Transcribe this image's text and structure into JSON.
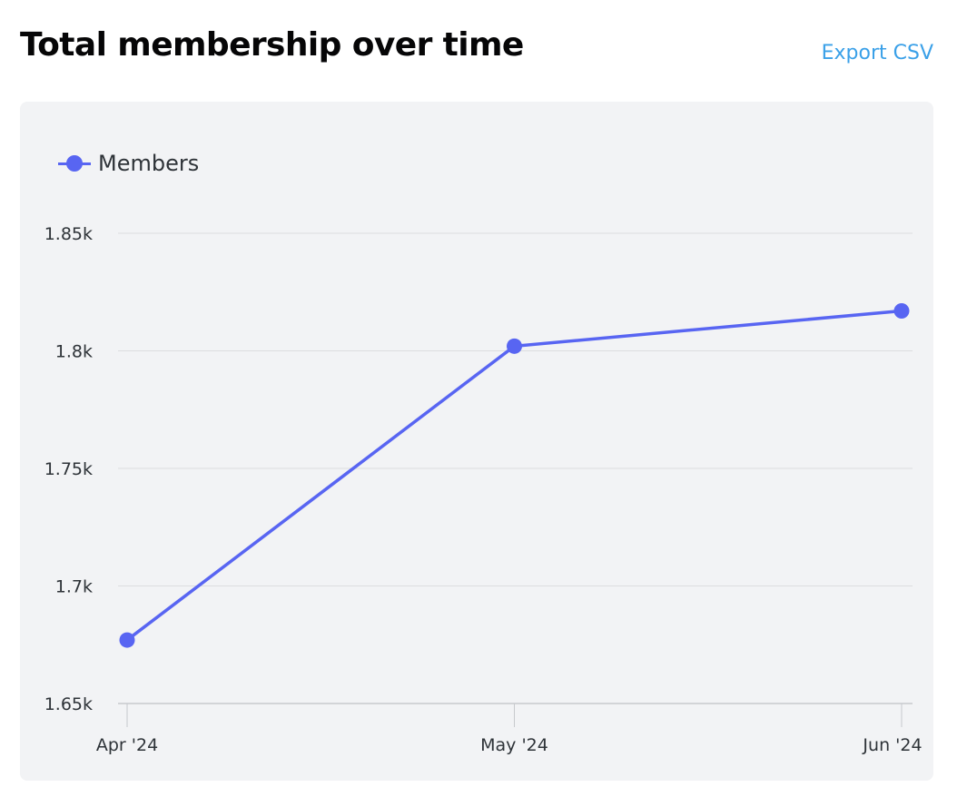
{
  "header": {
    "title": "Total membership over time",
    "export_label": "Export CSV"
  },
  "colors": {
    "accent": "#5865f2",
    "link": "#3aa0e8",
    "card_background": "#f2f3f5",
    "gridline": "#dcdde0"
  },
  "chart_data": {
    "type": "line",
    "title": "",
    "xlabel": "",
    "ylabel": "",
    "categories": [
      "Apr '24",
      "May '24",
      "Jun '24"
    ],
    "series": [
      {
        "name": "Members",
        "values": [
          1677,
          1802,
          1817
        ]
      }
    ],
    "ylim": [
      1650,
      1850
    ],
    "yticks": [
      1650,
      1700,
      1750,
      1800,
      1850
    ],
    "ytick_labels": [
      "1.65k",
      "1.7k",
      "1.75k",
      "1.8k",
      "1.85k"
    ],
    "grid": true,
    "legend": "top-left"
  }
}
